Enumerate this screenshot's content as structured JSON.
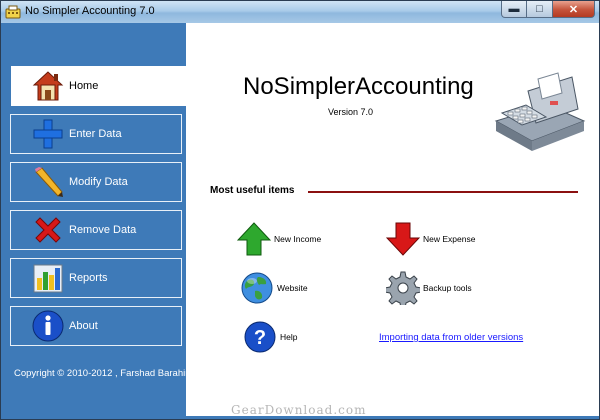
{
  "window": {
    "title": "No Simpler Accounting 7.0",
    "buttons": {
      "minimize": "▬",
      "maximize": "□",
      "close": "✕"
    }
  },
  "sidebar": {
    "items": [
      {
        "label": "Home",
        "icon": "house-icon",
        "active": true
      },
      {
        "label": "Enter Data",
        "icon": "plus-icon"
      },
      {
        "label": "Modify Data",
        "icon": "pencil-icon"
      },
      {
        "label": "Remove Data",
        "icon": "red-x-icon"
      },
      {
        "label": "Reports",
        "icon": "bar-chart-icon"
      },
      {
        "label": "About",
        "icon": "info-icon"
      }
    ],
    "copyright": "Copyright © 2010-2012 , Farshad Barahimi"
  },
  "main": {
    "app_title": "NoSimplerAccounting",
    "version": "Version 7.0",
    "section_title": "Most useful items",
    "items": [
      {
        "label": "New Income",
        "icon": "green-up-arrow-icon"
      },
      {
        "label": "New Expense",
        "icon": "red-down-arrow-icon"
      },
      {
        "label": "Website",
        "icon": "globe-icon"
      },
      {
        "label": "Backup tools",
        "icon": "gear-icon"
      },
      {
        "label": "Help",
        "icon": "help-icon"
      }
    ],
    "import_link": "Importing data from older versions"
  },
  "watermark": "GearDownload.com",
  "colors": {
    "sidebar_bg": "#3e7ab8",
    "section_line": "#8b1010",
    "link": "#1a1aff"
  }
}
